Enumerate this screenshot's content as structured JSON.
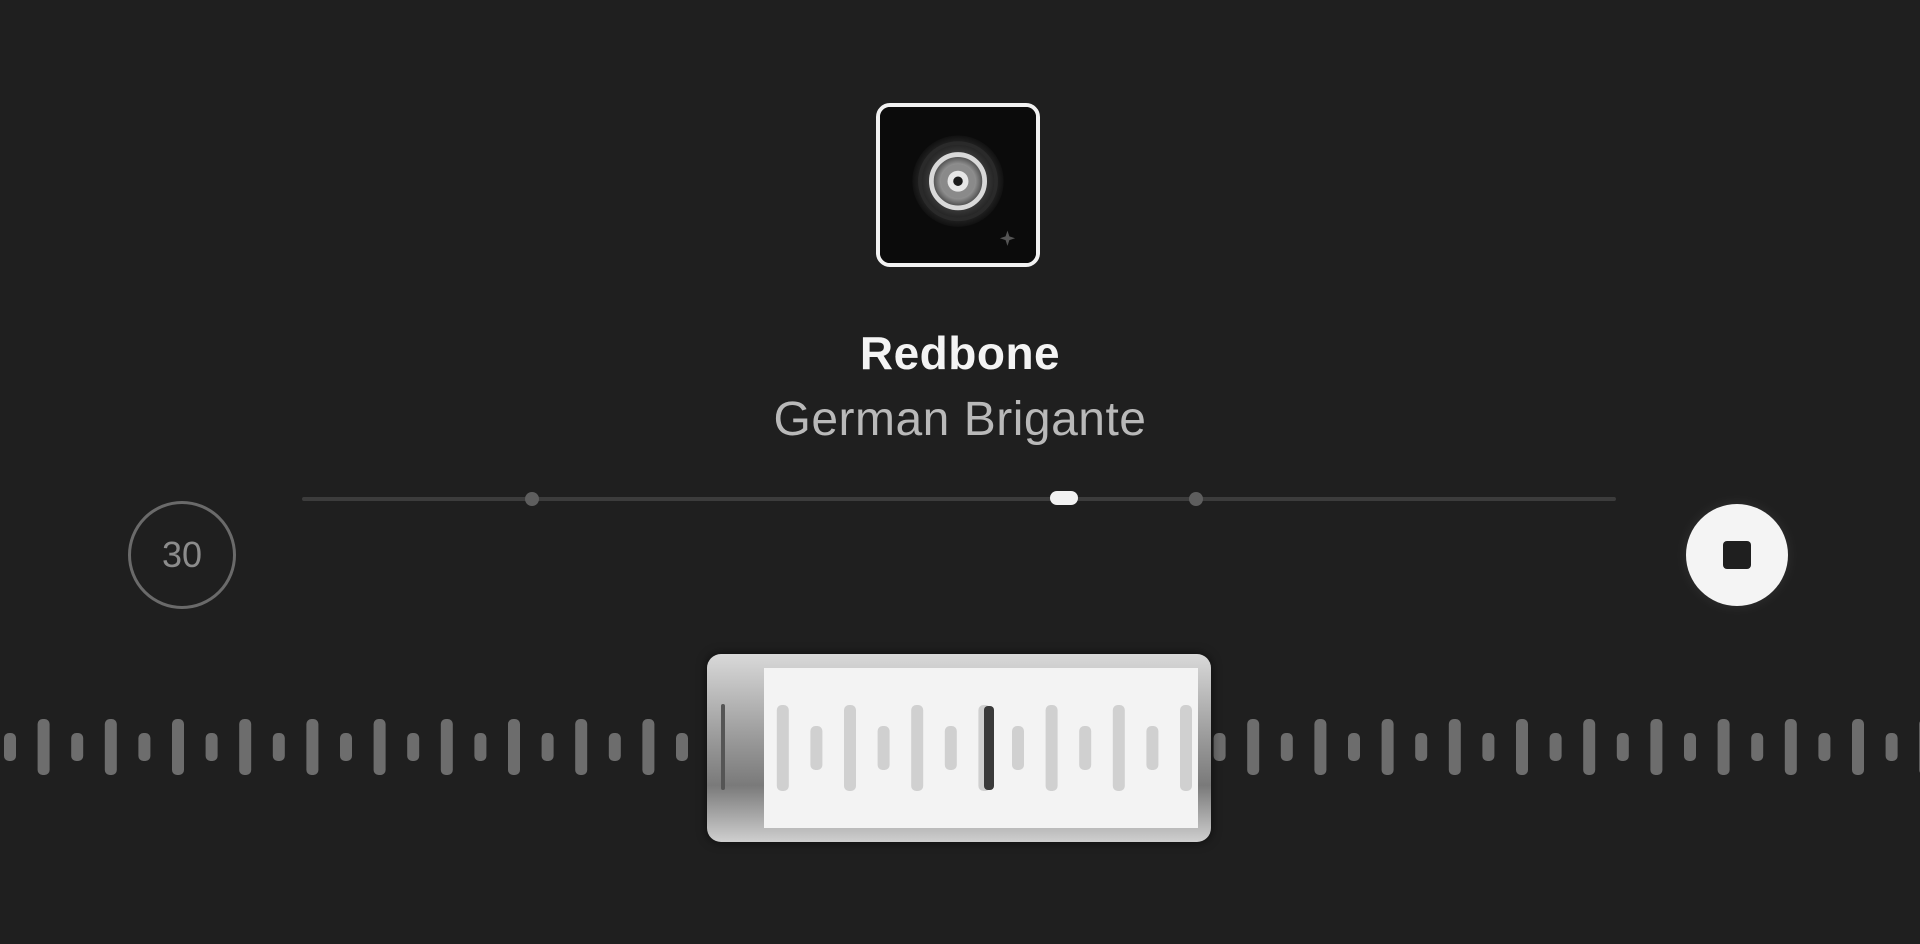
{
  "now_playing": {
    "title": "Redbone",
    "artist": "German Brigante",
    "artwork_icon": "vinyl-record-icon"
  },
  "controls": {
    "skip_label": "30",
    "stop_icon": "stop-icon"
  },
  "progress": {
    "position_fraction": 0.58,
    "markers": [
      0.175,
      0.68
    ]
  },
  "colors": {
    "background": "#1f1f1f",
    "accent": "#f2f2f2",
    "muted": "#6a6a6a"
  }
}
